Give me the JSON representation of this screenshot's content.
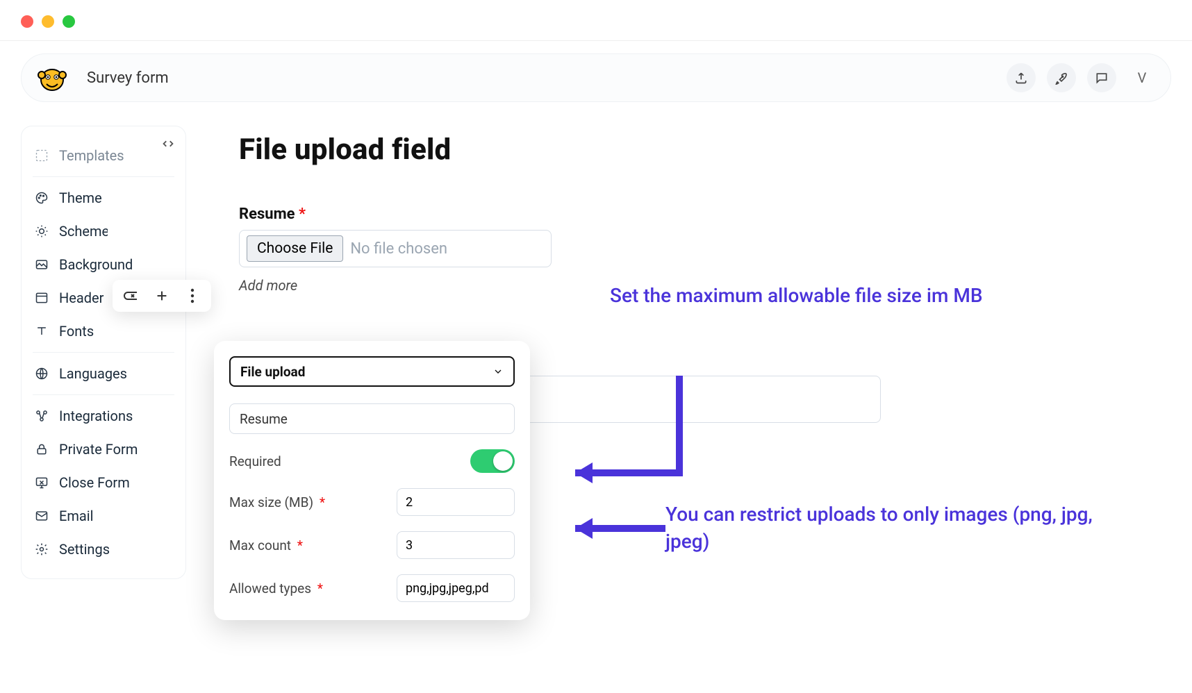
{
  "header": {
    "title": "Survey form",
    "avatar_initial": "V"
  },
  "sidebar": {
    "items": [
      {
        "label": "Templates",
        "muted": true
      },
      {
        "label": "Theme"
      },
      {
        "label": "Scheme"
      },
      {
        "label": "Background"
      },
      {
        "label": "Header"
      },
      {
        "label": "Fonts"
      },
      {
        "label": "Languages"
      },
      {
        "label": "Integrations"
      },
      {
        "label": "Private Form"
      },
      {
        "label": "Close Form"
      },
      {
        "label": "Email"
      },
      {
        "label": "Settings"
      }
    ]
  },
  "page": {
    "title": "File upload field",
    "resume_label": "Resume",
    "choose_btn": "Choose File",
    "no_file": "No file chosen",
    "add_more": "Add more"
  },
  "popover": {
    "type": "File upload",
    "name": "Resume",
    "required_label": "Required",
    "required_on": true,
    "max_size_label": "Max size (MB)",
    "max_size": "2",
    "max_count_label": "Max count",
    "max_count": "3",
    "allowed_types_label": "Allowed types",
    "allowed_types": "png,jpg,jpeg,pd"
  },
  "annotations": {
    "a1": "Set the maximum allowable file size im MB",
    "a2": "You can restrict uploads to only images (png, jpg, jpeg)"
  }
}
